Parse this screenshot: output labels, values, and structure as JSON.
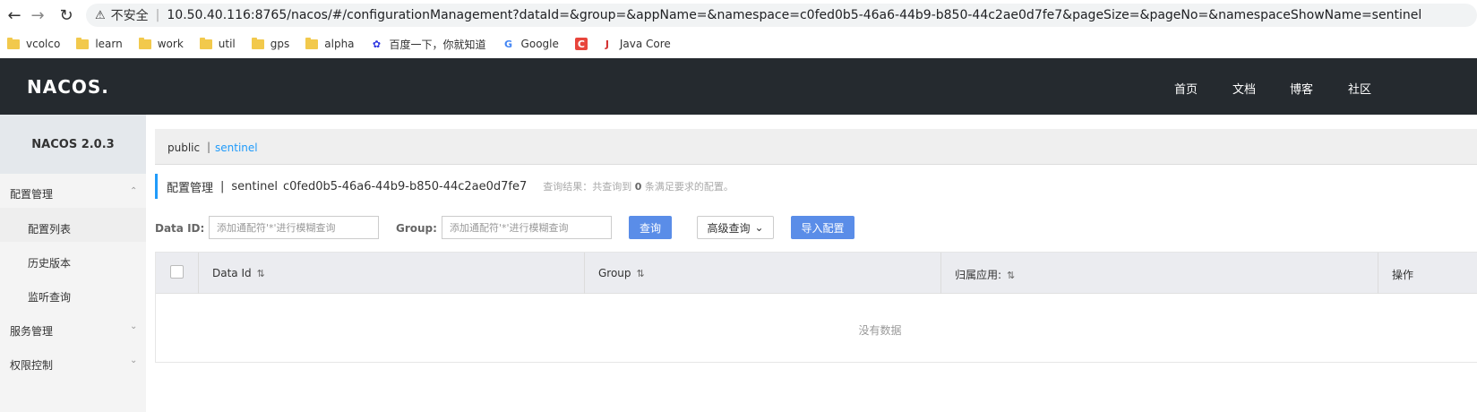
{
  "browser": {
    "insecure_label": "不安全",
    "url": "10.50.40.116:8765/nacos/#/configurationManagement?dataId=&group=&appName=&namespace=c0fed0b5-46a6-44b9-b850-44c2ae0d7fe7&pageSize=&pageNo=&namespaceShowName=sentinel",
    "bookmarks": [
      "vcolco",
      "learn",
      "work",
      "util",
      "gps",
      "alpha",
      "百度一下，你就知道",
      "Google",
      "Java Core"
    ]
  },
  "header": {
    "logo": "NACOS.",
    "nav": [
      "首页",
      "文档",
      "博客",
      "社区"
    ]
  },
  "sidebar": {
    "title": "NACOS 2.0.3",
    "groups": [
      {
        "label": "配置管理",
        "items": [
          "配置列表",
          "历史版本",
          "监听查询"
        ]
      },
      {
        "label": "服务管理"
      },
      {
        "label": "权限控制"
      }
    ]
  },
  "namespaces": {
    "public": "public",
    "separator": "|",
    "current": "sentinel"
  },
  "page": {
    "title": "配置管理",
    "pipe": "|",
    "ns_name": "sentinel",
    "ns_id": "c0fed0b5-46a6-44b9-b850-44c2ae0d7fe7",
    "query_prefix": "查询结果：共查询到",
    "query_count": "0",
    "query_suffix": "条满足要求的配置。"
  },
  "filters": {
    "dataid_label": "Data ID:",
    "dataid_placeholder": "添加通配符'*'进行模糊查询",
    "group_label": "Group:",
    "group_placeholder": "添加通配符'*'进行模糊查询",
    "search_button": "查询",
    "advanced_button": "高级查询",
    "import_button": "导入配置"
  },
  "table": {
    "columns": [
      "Data Id",
      "Group",
      "归属应用:",
      "操作"
    ],
    "empty_text": "没有数据"
  }
}
